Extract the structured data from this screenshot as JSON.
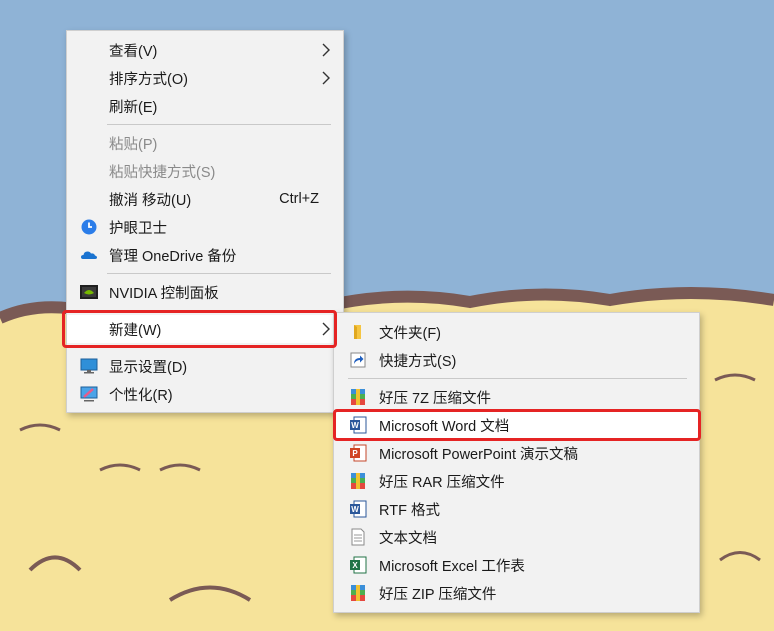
{
  "context_menu": {
    "items": [
      {
        "label": "查看(V)",
        "submenu": true
      },
      {
        "label": "排序方式(O)",
        "submenu": true
      },
      {
        "label": "刷新(E)"
      },
      {
        "label": "粘贴(P)",
        "disabled": true
      },
      {
        "label": "粘贴快捷方式(S)",
        "disabled": true
      },
      {
        "label": "撤消 移动(U)",
        "shortcut": "Ctrl+Z"
      },
      {
        "label": "护眼卫士",
        "icon": "eye-guard-icon"
      },
      {
        "label": "管理 OneDrive 备份",
        "icon": "onedrive-cloud-icon"
      },
      {
        "label": "NVIDIA 控制面板",
        "icon": "nvidia-icon"
      },
      {
        "label": "新建(W)",
        "submenu": true,
        "highlighted": true
      },
      {
        "label": "显示设置(D)",
        "icon": "display-settings-icon"
      },
      {
        "label": "个性化(R)",
        "icon": "personalize-icon"
      }
    ]
  },
  "new_submenu": {
    "items": [
      {
        "label": "文件夹(F)",
        "icon": "folder-icon"
      },
      {
        "label": "快捷方式(S)",
        "icon": "shortcut-icon"
      },
      {
        "label": "好压 7Z 压缩文件",
        "icon": "archive-7z-icon"
      },
      {
        "label": "Microsoft Word 文档",
        "icon": "word-document-icon",
        "highlighted": true
      },
      {
        "label": "Microsoft PowerPoint 演示文稿",
        "icon": "powerpoint-icon"
      },
      {
        "label": "好压 RAR 压缩文件",
        "icon": "archive-rar-icon"
      },
      {
        "label": "RTF 格式",
        "icon": "rtf-document-icon"
      },
      {
        "label": "文本文档",
        "icon": "text-document-icon"
      },
      {
        "label": "Microsoft Excel 工作表",
        "icon": "excel-icon"
      },
      {
        "label": "好压 ZIP 压缩文件",
        "icon": "archive-zip-icon"
      }
    ]
  },
  "colors": {
    "highlight_box": "#e52424",
    "menu_bg": "#f2f2f2",
    "sky": "#8fb3d6",
    "sand": "#f6e39a"
  }
}
